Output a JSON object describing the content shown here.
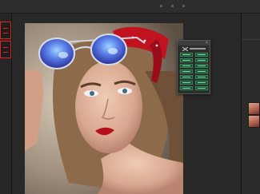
{
  "application": {
    "panel_close_glyph": "×"
  },
  "plugin_panel": {
    "buttons": [
      {
        "icon": "plugin-action"
      },
      {
        "icon": "plugin-action"
      },
      {
        "icon": "plugin-action"
      },
      {
        "icon": "plugin-action"
      },
      {
        "icon": "plugin-action"
      },
      {
        "icon": "plugin-action"
      },
      {
        "icon": "plugin-action"
      },
      {
        "icon": "plugin-action"
      },
      {
        "icon": "plugin-action"
      },
      {
        "icon": "plugin-action"
      },
      {
        "icon": "plugin-action"
      },
      {
        "icon": "plugin-action"
      },
      {
        "icon": "plugin-action"
      },
      {
        "icon": "plugin-action"
      }
    ]
  },
  "colors": {
    "workspace": "#282828",
    "highlight_red": "#e0231f",
    "panel_button_green": "#2f8a59",
    "bandana_red": "#c1121f",
    "lips_red": "#b3101c"
  },
  "icons": [
    "tool-icon",
    "tool-icon",
    "close-icon",
    "plugin-logo-icon"
  ]
}
